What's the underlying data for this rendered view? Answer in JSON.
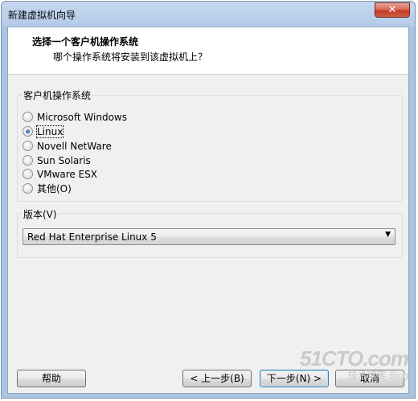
{
  "window": {
    "title": "新建虚拟机向导",
    "close_label": "✕"
  },
  "header": {
    "title": "选择一个客户机操作系统",
    "subtitle": "哪个操作系统将安装到该虚拟机上？"
  },
  "os_group": {
    "label": "客户机操作系统",
    "options": [
      {
        "label": "Microsoft Windows",
        "checked": false
      },
      {
        "label": "Linux",
        "checked": true
      },
      {
        "label": "Novell NetWare",
        "checked": false
      },
      {
        "label": "Sun Solaris",
        "checked": false
      },
      {
        "label": "VMware ESX",
        "checked": false
      },
      {
        "label": "其他(O)",
        "checked": false
      }
    ]
  },
  "version_group": {
    "label": "版本(V)",
    "selected": "Red Hat Enterprise Linux 5"
  },
  "buttons": {
    "help": "帮助",
    "back": "< 上一步(B)",
    "next": "下一步(N) >",
    "cancel": "取消"
  },
  "watermark": {
    "main": "51CTO.com",
    "sub": "技术博客 Blog"
  }
}
